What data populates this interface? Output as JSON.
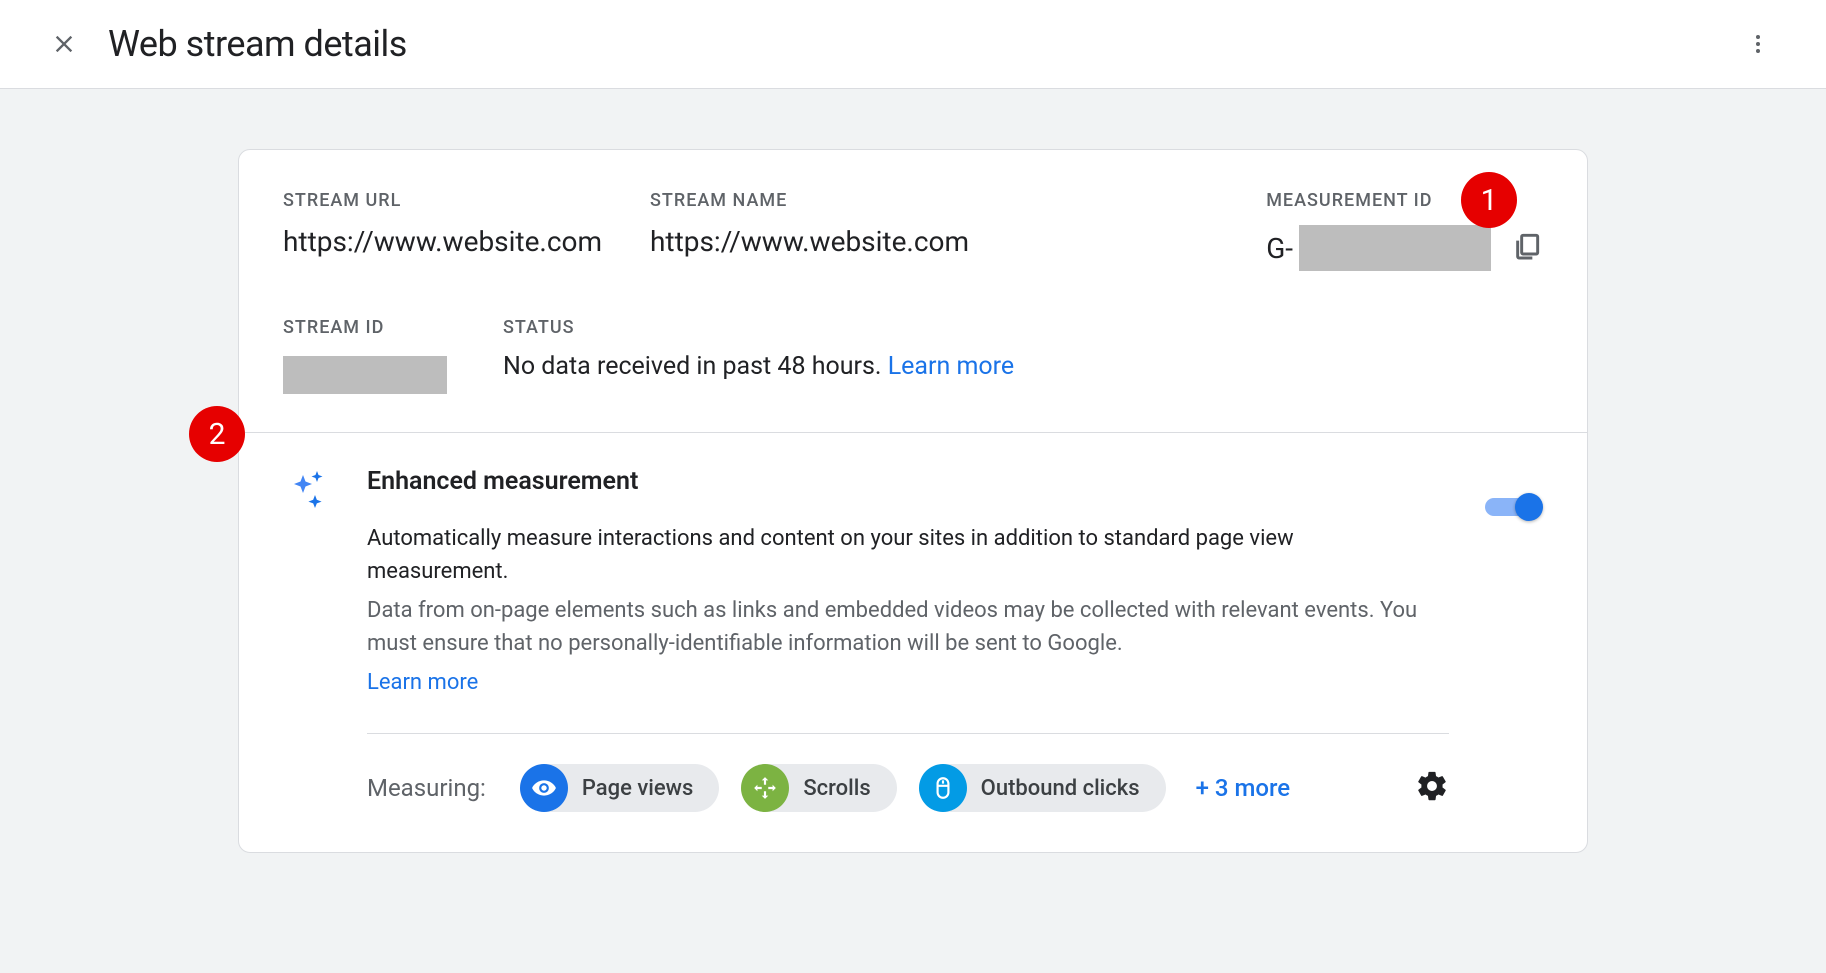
{
  "header": {
    "title": "Web stream details"
  },
  "stream": {
    "url_label": "STREAM URL",
    "url_value": "https://www.website.com",
    "name_label": "STREAM NAME",
    "name_value": "https://www.website.com",
    "measurement_label": "MEASUREMENT ID",
    "measurement_prefix": "G-",
    "id_label": "STREAM ID",
    "status_label": "STATUS",
    "status_text": "No data received in past 48 hours. ",
    "status_link": "Learn more"
  },
  "enhanced": {
    "title": "Enhanced measurement",
    "description": "Automatically measure interactions and content on your sites in addition to standard page view measurement.",
    "subtext": "Data from on-page elements such as links and embedded videos may be collected with relevant events. You must ensure that no personally-identifiable information will be sent to Google.",
    "learn_more": "Learn more",
    "measuring_label": "Measuring:",
    "chips": {
      "page_views": "Page views",
      "scrolls": "Scrolls",
      "outbound": "Outbound clicks"
    },
    "more_link": "+ 3 more"
  },
  "annotations": {
    "a1": "1",
    "a2": "2"
  }
}
